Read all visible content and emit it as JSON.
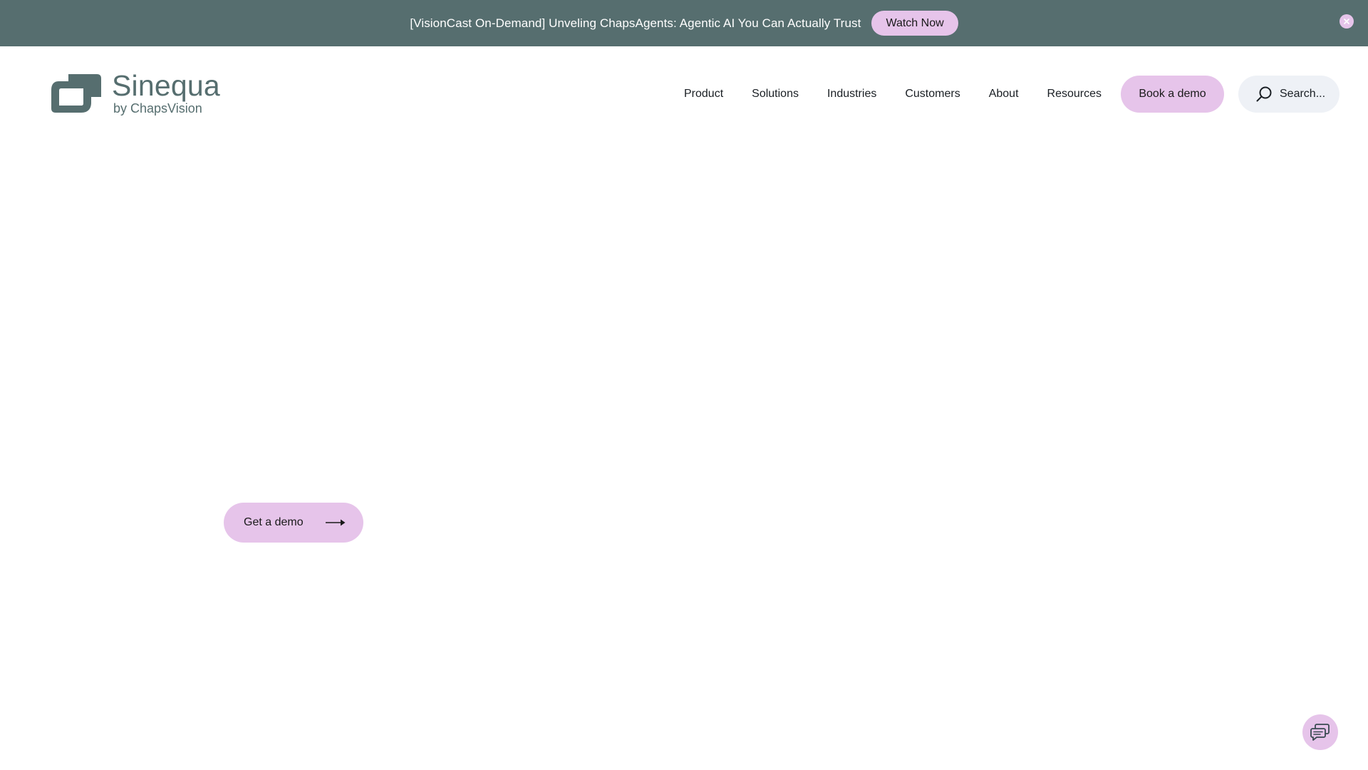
{
  "banner": {
    "text": "[VisionCast On-Demand] Unveling ChapsAgents: Agentic AI You Can Actually Trust",
    "button_label": "Watch Now",
    "close_icon": "close-icon"
  },
  "header": {
    "logo": {
      "name": "Sinequa",
      "subtitle": "by ChapsVision"
    },
    "nav": [
      "Product",
      "Solutions",
      "Industries",
      "Customers",
      "About",
      "Resources"
    ],
    "book_label": "Book a demo",
    "search_placeholder": "Search...",
    "search_icon": "search-icon"
  },
  "hero": {
    "cta_label": "Get a demo",
    "cta_icon": "arrow-right-icon"
  },
  "chat": {
    "icon": "chat-icon"
  },
  "colors": {
    "banner_bg": "#566e6f",
    "accent": "#e6c4ea",
    "brand": "#566e6f",
    "search_bg": "#eef1f6"
  }
}
